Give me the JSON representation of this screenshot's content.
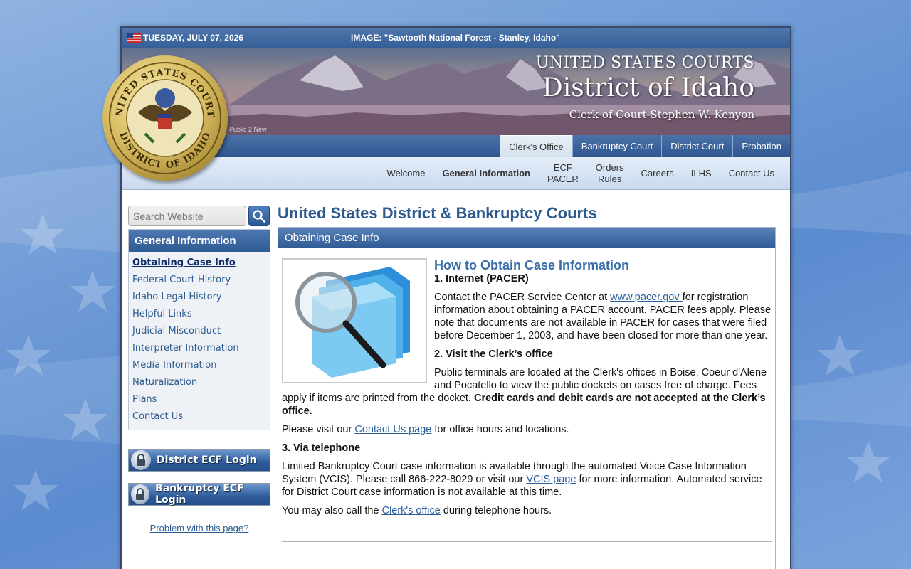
{
  "topbar": {
    "date": "TUESDAY, JULY 07, 2026",
    "image_caption": "IMAGE: \"Sawtooth National Forest - Stanley, Idaho\""
  },
  "banner": {
    "line1": "UNITED STATES COURTS",
    "line2": "District of Idaho",
    "line3": "Clerk of Court Stephen W. Kenyon",
    "faint_label": "Public 2 New"
  },
  "seal": {
    "top_text": "UNITED STATES COURTS",
    "bottom_text": "DISTRICT OF IDAHO"
  },
  "tabs": [
    {
      "label": "Clerk's Office",
      "active": true
    },
    {
      "label": "Bankruptcy Court",
      "active": false
    },
    {
      "label": "District Court",
      "active": false
    },
    {
      "label": "Probation",
      "active": false
    }
  ],
  "subnav": [
    {
      "label": "Welcome",
      "bold": false
    },
    {
      "label": "General Information",
      "bold": true
    },
    {
      "label": "ECF\nPACER",
      "bold": false
    },
    {
      "label": "Orders\nRules",
      "bold": false
    },
    {
      "label": "Careers",
      "bold": false
    },
    {
      "label": "ILHS",
      "bold": false
    },
    {
      "label": "Contact Us",
      "bold": false
    }
  ],
  "search": {
    "placeholder": "Search Website",
    "icon": "search-icon"
  },
  "sidebar": {
    "heading": "General Information",
    "items": [
      {
        "label": "Obtaining Case Info",
        "current": true
      },
      {
        "label": "Federal Court History",
        "current": false
      },
      {
        "label": "Idaho Legal History",
        "current": false
      },
      {
        "label": "Helpful Links",
        "current": false
      },
      {
        "label": "Judicial Misconduct",
        "current": false
      },
      {
        "label": "Interpreter Information",
        "current": false
      },
      {
        "label": "Media Information",
        "current": false
      },
      {
        "label": "Naturalization",
        "current": false
      },
      {
        "label": "Plans",
        "current": false
      },
      {
        "label": "Contact Us",
        "current": false
      }
    ],
    "ecf_buttons": [
      "District ECF Login",
      "Bankruptcy ECF Login"
    ],
    "problem_link": "Problem with this page?"
  },
  "main": {
    "title": "United States District & Bankruptcy Courts",
    "panel_title": "Obtaining Case Info",
    "heading": "How to Obtain Case Information",
    "s1_title": "1.  Internet (PACER)",
    "s1_p_pre": "Contact the PACER Service Center at ",
    "s1_link": "www.pacer.gov ",
    "s1_p_post": "for registration information about obtaining a PACER account. PACER fees apply. Please note that documents are not available in PACER for cases that were filed before December 1, 2003, and have been closed for more than one year.",
    "s2_title": "2.  Visit the Clerk’s office",
    "s2_p": "Public terminals are located at the Clerk's offices in Boise, Coeur d'Alene and Pocatello to view the public dockets on cases free of charge. Fees apply if items are printed from the docket.  ",
    "s2_bold": "Credit cards and debit cards are not accepted at the Clerk’s office.",
    "s2_visit_pre": "Please visit our ",
    "s2_visit_link": "Contact Us page",
    "s2_visit_post": " for office hours and locations.",
    "s3_title": "3. Via telephone",
    "s3_p_pre": "Limited Bankruptcy Court case information is available through the automated Voice Case Information System (VCIS). Please call 866-222-8029 or visit our ",
    "s3_link": "VCIS page",
    "s3_p_post": " for more information. Automated service for District Court case information is not available at this time.",
    "s3_call_pre": "You may also call the ",
    "s3_call_link": "Clerk's office",
    "s3_call_post": " during telephone hours."
  },
  "colors": {
    "accent": "#2f5a8e",
    "link": "#2a5d9a",
    "tab_bar": "#3a63a0"
  }
}
